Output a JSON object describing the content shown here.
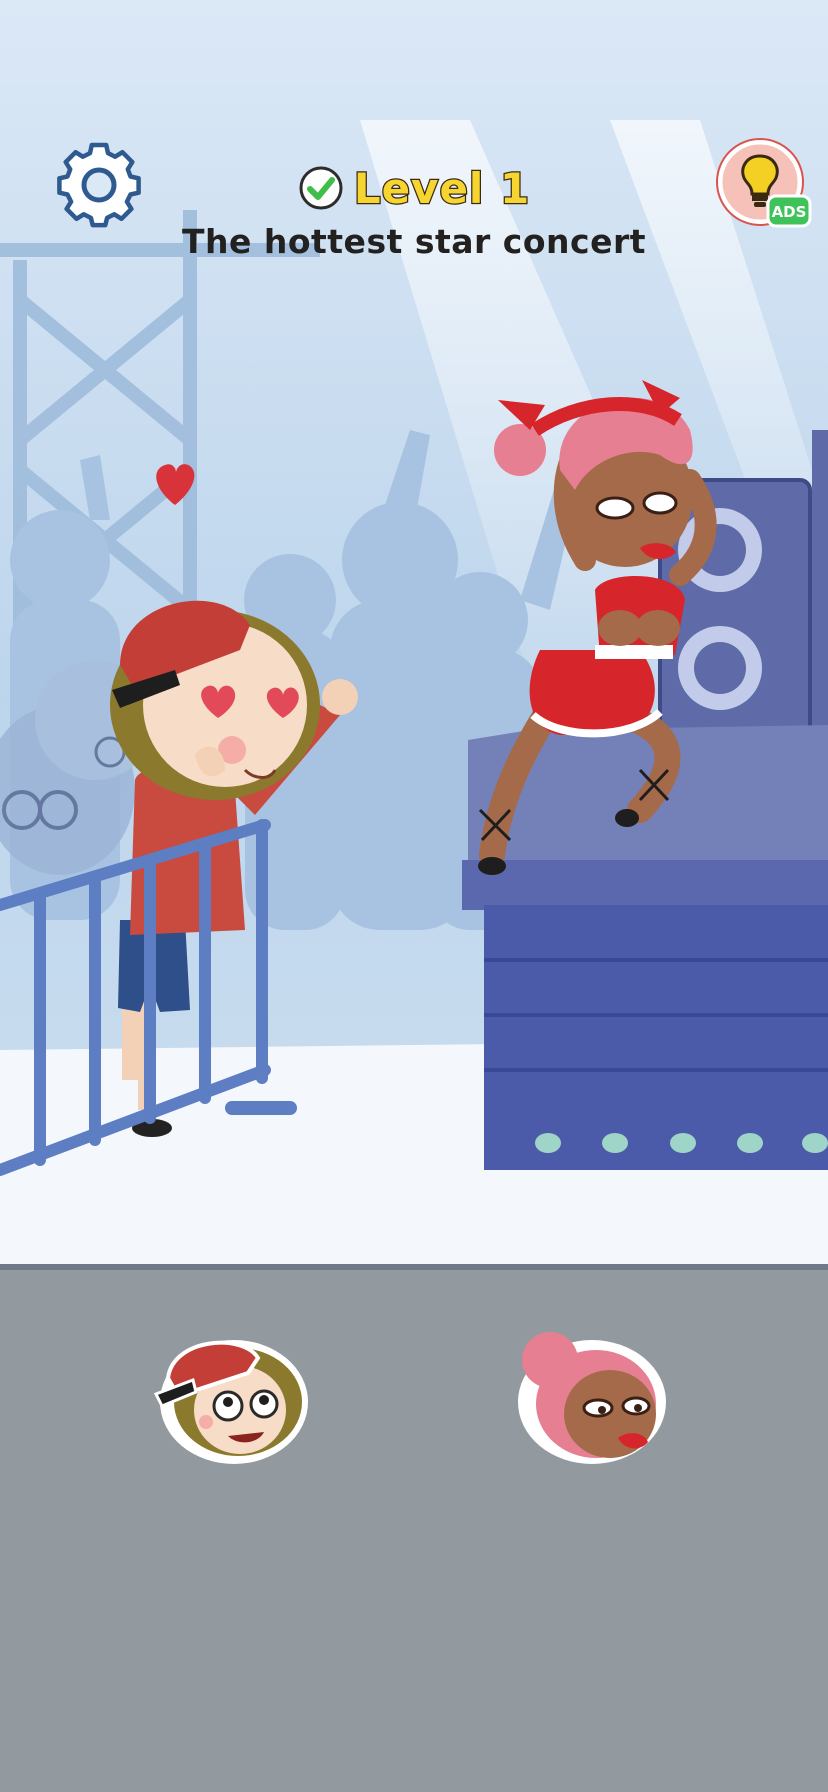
{
  "hud": {
    "settings_icon": "gear-icon",
    "hint_icon": "lightbulb-icon",
    "hint_badge": "ADS",
    "level_check_icon": "check-icon"
  },
  "level": {
    "label": "Level 1",
    "title": "The hottest star concert",
    "completed": true
  },
  "scene": {
    "characters": [
      "boy-fan",
      "pop-star"
    ],
    "props": [
      "stage",
      "speaker",
      "barrier",
      "heart"
    ]
  },
  "tray": {
    "stickers": [
      {
        "id": "boy",
        "icon": "boy-face-sticker"
      },
      {
        "id": "girl",
        "icon": "girl-face-sticker"
      }
    ]
  },
  "colors": {
    "sky": "#c5dbef",
    "level_text": "#f6d531",
    "title_text": "#22211f",
    "tray": "#929a9f",
    "stage": "#4b5ba9",
    "ads_badge": "#3fc25a"
  }
}
